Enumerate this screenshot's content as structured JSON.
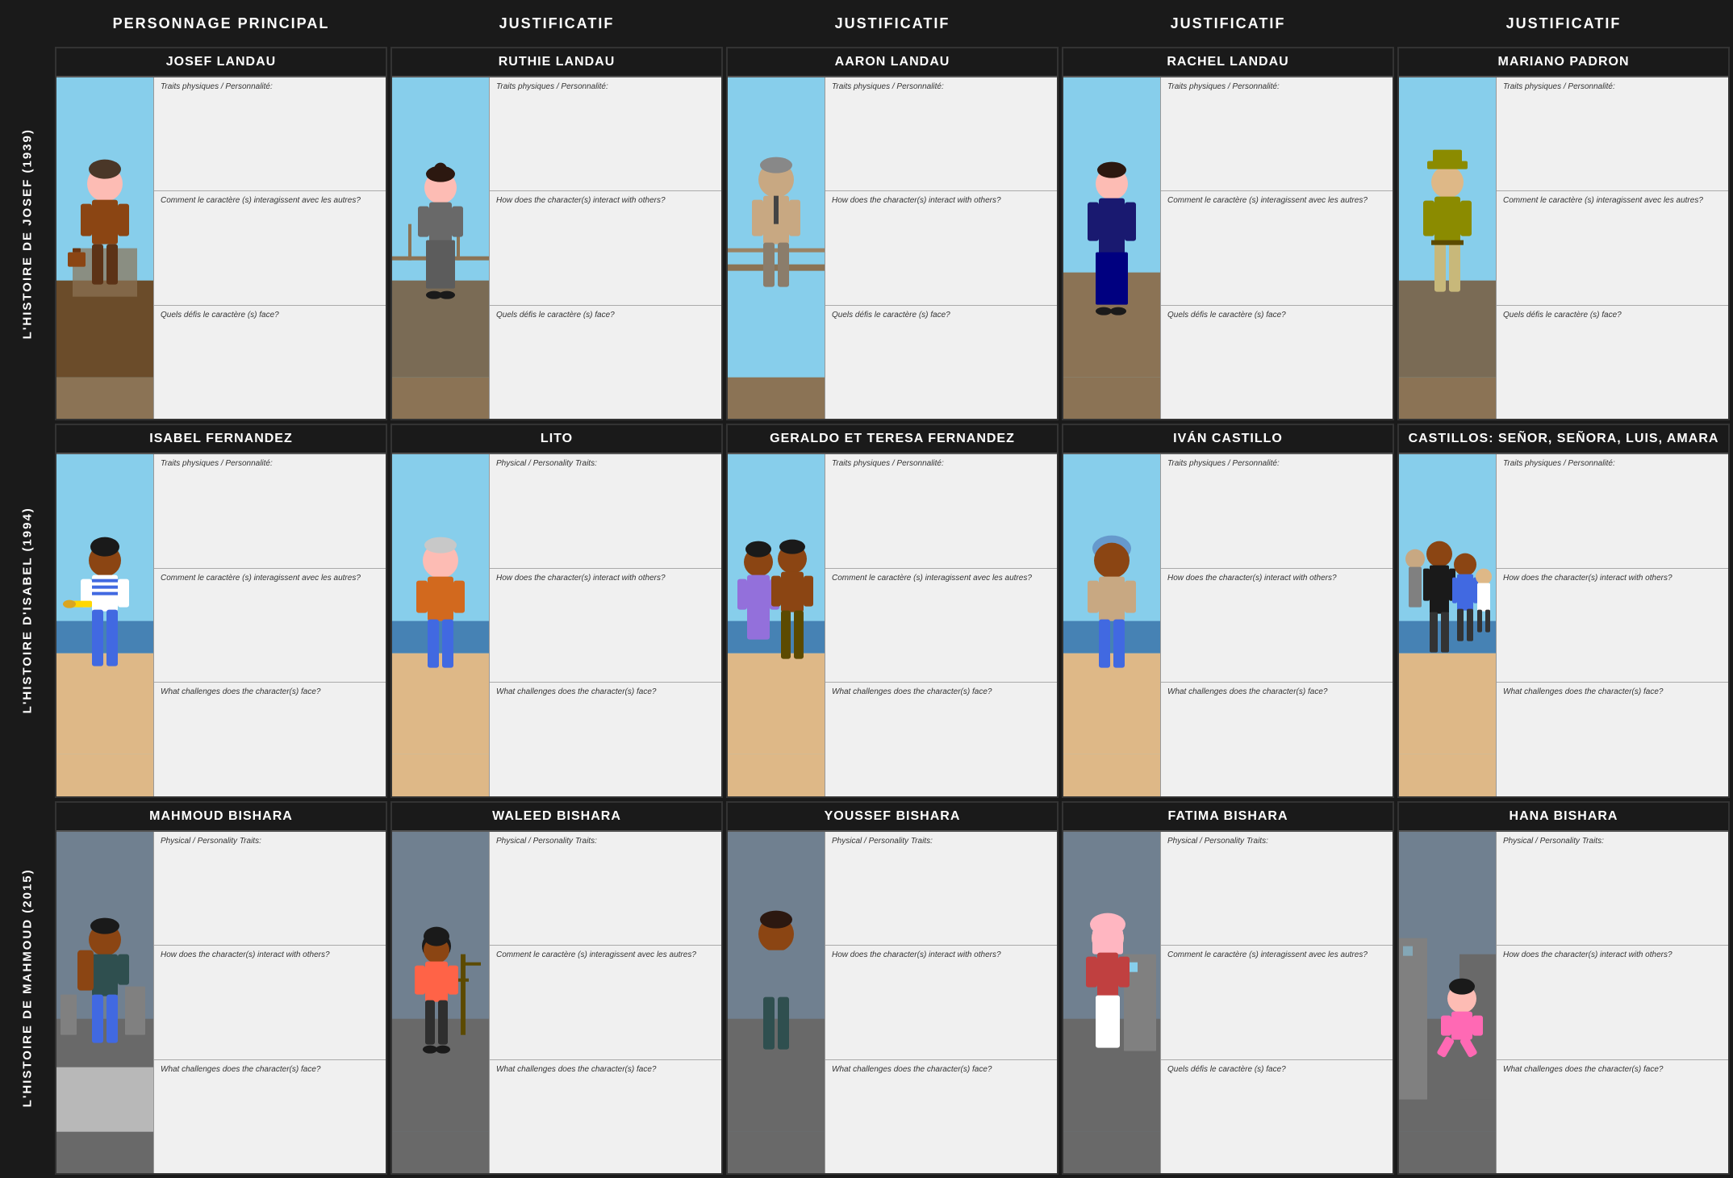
{
  "headers": {
    "col0": "",
    "col1": "PERSONNAGE PRINCIPAL",
    "col2": "JUSTIFICATIF",
    "col3": "JUSTIFICATIF",
    "col4": "JUSTIFICATIF",
    "col5": "JUSTIFICATIF"
  },
  "rows": [
    {
      "label": "L'HISTOIRE DE JOSEF (1939)",
      "characters": [
        {
          "name": "JOSEF LANDAU",
          "bg": "ship",
          "fields": [
            "Traits physiques / Personnalité:",
            "Comment le caractère (s) interagissent avec les autres?",
            "Quels défis le caractère (s) face?"
          ],
          "figure": "boy_suit"
        },
        {
          "name": "RUTHIE LANDAU",
          "bg": "ship",
          "fields": [
            "Traits physiques / Personnalité:",
            "How does the character(s) interact with others?",
            "Quels défis le caractère (s) face?"
          ],
          "figure": "woman_dress"
        },
        {
          "name": "AARON LANDAU",
          "bg": "ship",
          "fields": [
            "Traits physiques / Personnalité:",
            "How does the character(s) interact with others?",
            "Quels défis le caractère (s) face?"
          ],
          "figure": "man_suit"
        },
        {
          "name": "RACHEL LANDAU",
          "bg": "ship",
          "fields": [
            "Traits physiques / Personnalité:",
            "Comment le caractère (s) interagissent avec les autres?",
            "Quels défis le caractère (s) face?"
          ],
          "figure": "woman_blue"
        },
        {
          "name": "MARIANO PADRON",
          "bg": "ship",
          "fields": [
            "Traits physiques / Personnalité:",
            "Comment le caractère (s) interagissent avec les autres?",
            "Quels défis le caractère (s) face?"
          ],
          "figure": "officer"
        }
      ]
    },
    {
      "label": "L'HISTOIRE D'ISABEL (1994)",
      "characters": [
        {
          "name": "ISABEL FERNANDEZ",
          "bg": "beach",
          "fields": [
            "Traits physiques / Personnalité:",
            "Comment le caractère (s) interagissent avec les autres?",
            "What challenges does the character(s) face?"
          ],
          "figure": "girl_stripes"
        },
        {
          "name": "LITO",
          "bg": "beach",
          "fields": [
            "Physical / Personality Traits:",
            "How does the character(s) interact with others?",
            "What challenges does the character(s) face?"
          ],
          "figure": "old_man"
        },
        {
          "name": "GERALDO ET TERESA FERNANDEZ",
          "bg": "beach",
          "fields": [
            "Traits physiques / Personnalité:",
            "Comment le caractère (s) interagissent avec les autres?",
            "What challenges does the character(s) face?"
          ],
          "figure": "couple"
        },
        {
          "name": "IVÁN CASTILLO",
          "bg": "beach",
          "fields": [
            "Traits physiques / Personnalité:",
            "How does the character(s) interact with others?",
            "What challenges does the character(s) face?"
          ],
          "figure": "man_helmet"
        },
        {
          "name": "CASTILLOS: SEÑOR, SEÑORA, LUIS, AMARA",
          "bg": "beach",
          "fields": [
            "Traits physiques / Personnalité:",
            "How does the character(s) interact with others?",
            "What challenges does the character(s) face?"
          ],
          "figure": "family_group"
        }
      ]
    },
    {
      "label": "L'HISTOIRE DE MAHMOUD (2015)",
      "characters": [
        {
          "name": "MAHMOUD BISHARA",
          "bg": "ruins",
          "fields": [
            "Physical / Personality Traits:",
            "How does the character(s) interact with others?",
            "What challenges does the character(s) face?"
          ],
          "figure": "boy_backpack"
        },
        {
          "name": "WALEED BISHARA",
          "bg": "ruins",
          "fields": [
            "Physical / Personality Traits:",
            "Comment le caractère (s) interagissent avec les autres?",
            "What challenges does the character(s) face?"
          ],
          "figure": "boy_red"
        },
        {
          "name": "YOUSSEF BISHARA",
          "bg": "ruins",
          "fields": [
            "Physical / Personality Traits:",
            "How does the character(s) interact with others?",
            "What challenges does the character(s) face?"
          ],
          "figure": "man_tall"
        },
        {
          "name": "FATIMA BISHARA",
          "bg": "ruins",
          "fields": [
            "Physical / Personality Traits:",
            "Comment le caractère (s) interagissent avec les autres?",
            "Quels défis le caractère (s) face?"
          ],
          "figure": "woman_hijab"
        },
        {
          "name": "HANA BISHARA",
          "bg": "ruins",
          "fields": [
            "Physical / Personality Traits:",
            "How does the character(s) interact with others?",
            "What challenges does the character(s) face?"
          ],
          "figure": "girl_pink"
        }
      ]
    }
  ]
}
